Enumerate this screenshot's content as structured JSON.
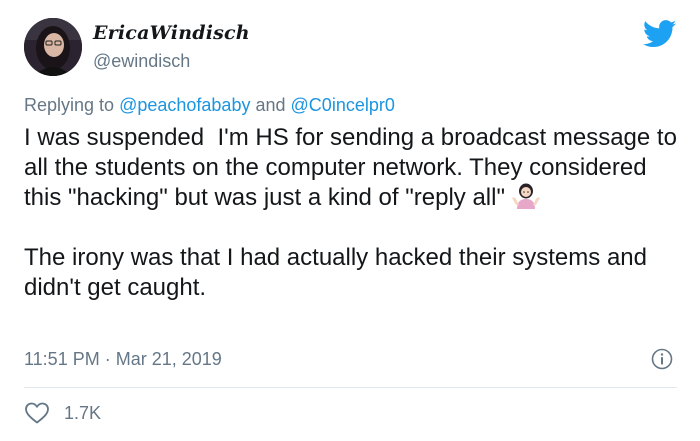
{
  "author": {
    "display_name": "EricaWindisch",
    "handle": "@ewindisch"
  },
  "reply_to": {
    "prefix": "Replying to",
    "mention_1": "@peachofababy",
    "conjunction": "and",
    "mention_2": "@C0incelpr0"
  },
  "tweet": {
    "paragraph_1": "I was suspended  I'm HS for sending a broadcast message to all the students on the computer network. They considered this \"hacking\" but was just a kind of \"reply all\"",
    "paragraph_1_emoji": "shrugging-woman-emoji",
    "paragraph_2": "The irony was that I had actually hacked their systems and didn't get caught."
  },
  "meta": {
    "time": "11:51 PM",
    "separator": "·",
    "date": "Mar 21, 2019"
  },
  "engagement": {
    "likes": "1.7K"
  },
  "icons": {
    "logo": "twitter-bird-icon",
    "info": "info-icon",
    "like": "heart-icon"
  },
  "colors": {
    "brand": "#1da1f2",
    "link": "#1b95e0",
    "muted": "#657786",
    "text": "#14171a",
    "divider": "#e1e8ed"
  }
}
